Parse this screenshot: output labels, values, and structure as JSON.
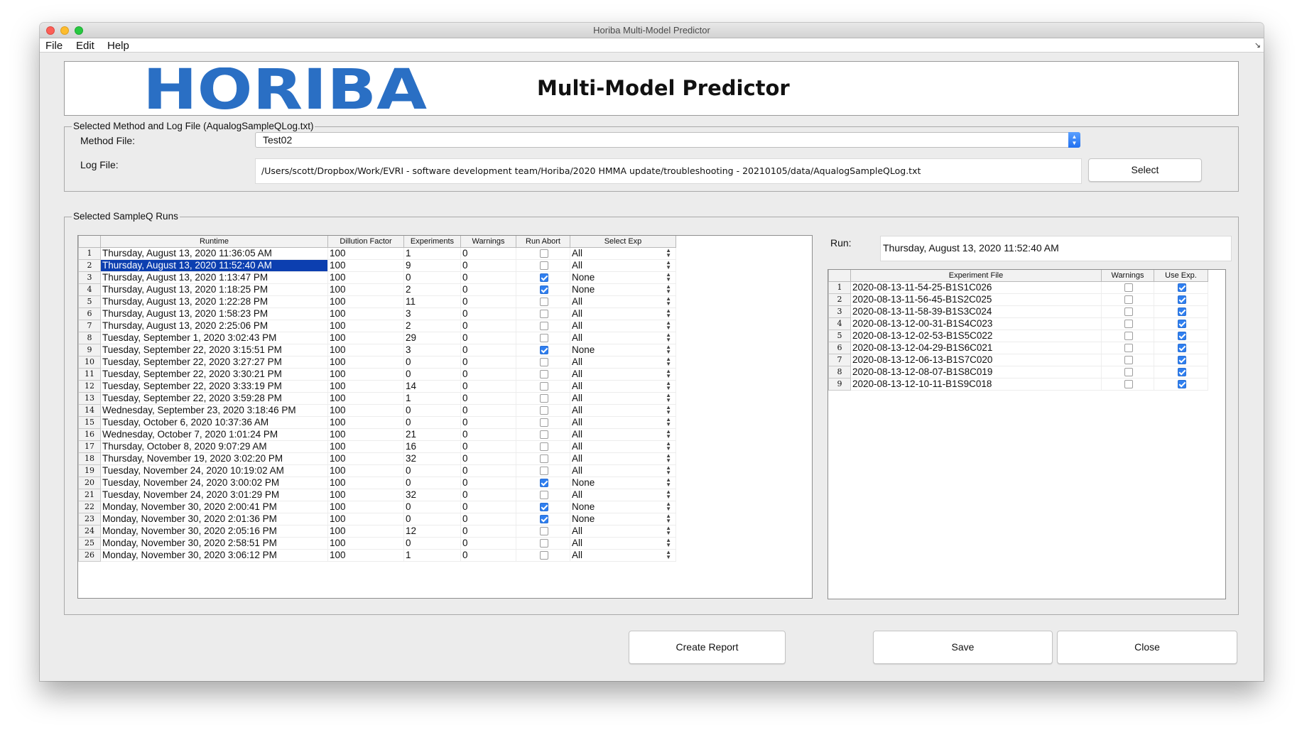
{
  "window": {
    "title": "Horiba Multi-Model Predictor"
  },
  "menu": [
    "File",
    "Edit",
    "Help"
  ],
  "header": {
    "logo_text": "HORIBA",
    "title": "Multi-Model Predictor",
    "logo_color": "#2a6fc4"
  },
  "method_group": {
    "title": "Selected Method and Log File (AqualogSampleQLog.txt)",
    "method_label": "Method File:",
    "method_value": "Test02",
    "log_label": "Log File:",
    "log_value": "/Users/scott/Dropbox/Work/EVRI - software development team/Horiba/2020 HMMA update/troubleshooting - 20210105/data/AqualogSampleQLog.txt",
    "select_label": "Select"
  },
  "runs_group": {
    "title": "Selected SampleQ Runs"
  },
  "runs_table": {
    "headers": [
      "Runtime",
      "Dillution Factor",
      "Experiments",
      "Warnings",
      "Run Abort",
      "Select Exp"
    ],
    "selected_index": 1,
    "rows": [
      {
        "num": "1",
        "runtime": "Thursday, August 13, 2020 11:36:05 AM",
        "dilution": "100",
        "experiments": "1",
        "warnings": "0",
        "abort": false,
        "select": "All"
      },
      {
        "num": "2",
        "runtime": "Thursday, August 13, 2020 11:52:40 AM",
        "dilution": "100",
        "experiments": "9",
        "warnings": "0",
        "abort": false,
        "select": "All"
      },
      {
        "num": "3",
        "runtime": "Thursday, August 13, 2020 1:13:47 PM",
        "dilution": "100",
        "experiments": "0",
        "warnings": "0",
        "abort": true,
        "select": "None"
      },
      {
        "num": "4",
        "runtime": "Thursday, August 13, 2020 1:18:25 PM",
        "dilution": "100",
        "experiments": "2",
        "warnings": "0",
        "abort": true,
        "select": "None"
      },
      {
        "num": "5",
        "runtime": "Thursday, August 13, 2020 1:22:28 PM",
        "dilution": "100",
        "experiments": "11",
        "warnings": "0",
        "abort": false,
        "select": "All"
      },
      {
        "num": "6",
        "runtime": "Thursday, August 13, 2020 1:58:23 PM",
        "dilution": "100",
        "experiments": "3",
        "warnings": "0",
        "abort": false,
        "select": "All"
      },
      {
        "num": "7",
        "runtime": "Thursday, August 13, 2020 2:25:06 PM",
        "dilution": "100",
        "experiments": "2",
        "warnings": "0",
        "abort": false,
        "select": "All"
      },
      {
        "num": "8",
        "runtime": "Tuesday, September 1, 2020 3:02:43 PM",
        "dilution": "100",
        "experiments": "29",
        "warnings": "0",
        "abort": false,
        "select": "All"
      },
      {
        "num": "9",
        "runtime": "Tuesday, September 22, 2020 3:15:51 PM",
        "dilution": "100",
        "experiments": "3",
        "warnings": "0",
        "abort": true,
        "select": "None"
      },
      {
        "num": "10",
        "runtime": "Tuesday, September 22, 2020 3:27:27 PM",
        "dilution": "100",
        "experiments": "0",
        "warnings": "0",
        "abort": false,
        "select": "All"
      },
      {
        "num": "11",
        "runtime": "Tuesday, September 22, 2020 3:30:21 PM",
        "dilution": "100",
        "experiments": "0",
        "warnings": "0",
        "abort": false,
        "select": "All"
      },
      {
        "num": "12",
        "runtime": "Tuesday, September 22, 2020 3:33:19 PM",
        "dilution": "100",
        "experiments": "14",
        "warnings": "0",
        "abort": false,
        "select": "All"
      },
      {
        "num": "13",
        "runtime": "Tuesday, September 22, 2020 3:59:28 PM",
        "dilution": "100",
        "experiments": "1",
        "warnings": "0",
        "abort": false,
        "select": "All"
      },
      {
        "num": "14",
        "runtime": "Wednesday, September 23, 2020 3:18:46 PM",
        "dilution": "100",
        "experiments": "0",
        "warnings": "0",
        "abort": false,
        "select": "All"
      },
      {
        "num": "15",
        "runtime": "Tuesday, October 6, 2020 10:37:36 AM",
        "dilution": "100",
        "experiments": "0",
        "warnings": "0",
        "abort": false,
        "select": "All"
      },
      {
        "num": "16",
        "runtime": "Wednesday, October 7, 2020 1:01:24 PM",
        "dilution": "100",
        "experiments": "21",
        "warnings": "0",
        "abort": false,
        "select": "All"
      },
      {
        "num": "17",
        "runtime": "Thursday, October 8, 2020 9:07:29 AM",
        "dilution": "100",
        "experiments": "16",
        "warnings": "0",
        "abort": false,
        "select": "All"
      },
      {
        "num": "18",
        "runtime": "Thursday, November 19, 2020 3:02:20 PM",
        "dilution": "100",
        "experiments": "32",
        "warnings": "0",
        "abort": false,
        "select": "All"
      },
      {
        "num": "19",
        "runtime": "Tuesday, November 24, 2020 10:19:02 AM",
        "dilution": "100",
        "experiments": "0",
        "warnings": "0",
        "abort": false,
        "select": "All"
      },
      {
        "num": "20",
        "runtime": "Tuesday, November 24, 2020 3:00:02 PM",
        "dilution": "100",
        "experiments": "0",
        "warnings": "0",
        "abort": true,
        "select": "None"
      },
      {
        "num": "21",
        "runtime": "Tuesday, November 24, 2020 3:01:29 PM",
        "dilution": "100",
        "experiments": "32",
        "warnings": "0",
        "abort": false,
        "select": "All"
      },
      {
        "num": "22",
        "runtime": "Monday, November 30, 2020 2:00:41 PM",
        "dilution": "100",
        "experiments": "0",
        "warnings": "0",
        "abort": true,
        "select": "None"
      },
      {
        "num": "23",
        "runtime": "Monday, November 30, 2020 2:01:36 PM",
        "dilution": "100",
        "experiments": "0",
        "warnings": "0",
        "abort": true,
        "select": "None"
      },
      {
        "num": "24",
        "runtime": "Monday, November 30, 2020 2:05:16 PM",
        "dilution": "100",
        "experiments": "12",
        "warnings": "0",
        "abort": false,
        "select": "All"
      },
      {
        "num": "25",
        "runtime": "Monday, November 30, 2020 2:58:51 PM",
        "dilution": "100",
        "experiments": "0",
        "warnings": "0",
        "abort": false,
        "select": "All"
      },
      {
        "num": "26",
        "runtime": "Monday, November 30, 2020 3:06:12 PM",
        "dilution": "100",
        "experiments": "1",
        "warnings": "0",
        "abort": false,
        "select": "All"
      }
    ]
  },
  "run_panel": {
    "label": "Run:",
    "value": "Thursday, August 13, 2020 11:52:40 AM"
  },
  "exp_table": {
    "headers": [
      "Experiment File",
      "Warnings",
      "Use Exp."
    ],
    "rows": [
      {
        "num": "1",
        "file": "2020-08-13-11-54-25-B1S1C026",
        "warning": false,
        "use": true
      },
      {
        "num": "2",
        "file": "2020-08-13-11-56-45-B1S2C025",
        "warning": false,
        "use": true
      },
      {
        "num": "3",
        "file": "2020-08-13-11-58-39-B1S3C024",
        "warning": false,
        "use": true
      },
      {
        "num": "4",
        "file": "2020-08-13-12-00-31-B1S4C023",
        "warning": false,
        "use": true
      },
      {
        "num": "5",
        "file": "2020-08-13-12-02-53-B1S5C022",
        "warning": false,
        "use": true
      },
      {
        "num": "6",
        "file": "2020-08-13-12-04-29-B1S6C021",
        "warning": false,
        "use": true
      },
      {
        "num": "7",
        "file": "2020-08-13-12-06-13-B1S7C020",
        "warning": false,
        "use": true
      },
      {
        "num": "8",
        "file": "2020-08-13-12-08-07-B1S8C019",
        "warning": false,
        "use": true
      },
      {
        "num": "9",
        "file": "2020-08-13-12-10-11-B1S9C018",
        "warning": false,
        "use": true
      }
    ]
  },
  "buttons": {
    "create_report": "Create Report",
    "save": "Save",
    "close": "Close"
  }
}
